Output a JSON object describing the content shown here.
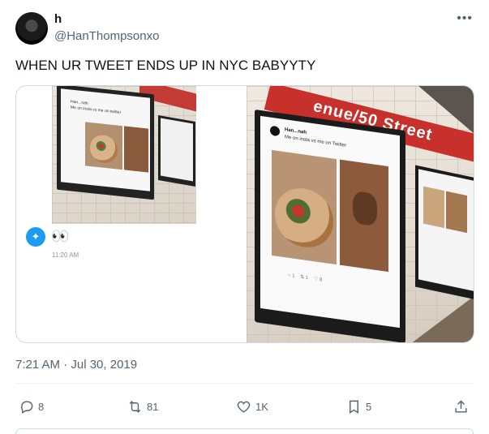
{
  "tweet": {
    "display_name": "h",
    "handle": "@HanThompsonxo",
    "text": "WHEN UR TWEET ENDS UP IN NYC BABYYTY",
    "timestamp": "7:21 AM · Jul 30, 2019",
    "more_icon": "more-horizontal-icon"
  },
  "media": {
    "left": {
      "mini_tweet_text": "Me on insta vs me on twitter",
      "mini_name": "Han...nah",
      "badge_icon": "twitter-bird-icon",
      "eyes": "👀",
      "time": "11:20 AM"
    },
    "right": {
      "sign_text": "enue/50 Street",
      "tw_name": "Han...nah",
      "tw_line": "Me on insta vs me on Twitter"
    }
  },
  "actions": {
    "reply": {
      "icon": "reply-icon",
      "count": "8"
    },
    "retweet": {
      "icon": "retweet-icon",
      "count": "81"
    },
    "like": {
      "icon": "heart-icon",
      "count": "1K"
    },
    "bookmark": {
      "icon": "bookmark-icon",
      "count": "5"
    },
    "share": {
      "icon": "share-icon"
    }
  },
  "colors": {
    "accent": "#1d9bf0",
    "secondary_text": "#536471",
    "station_red": "#c8302c"
  }
}
